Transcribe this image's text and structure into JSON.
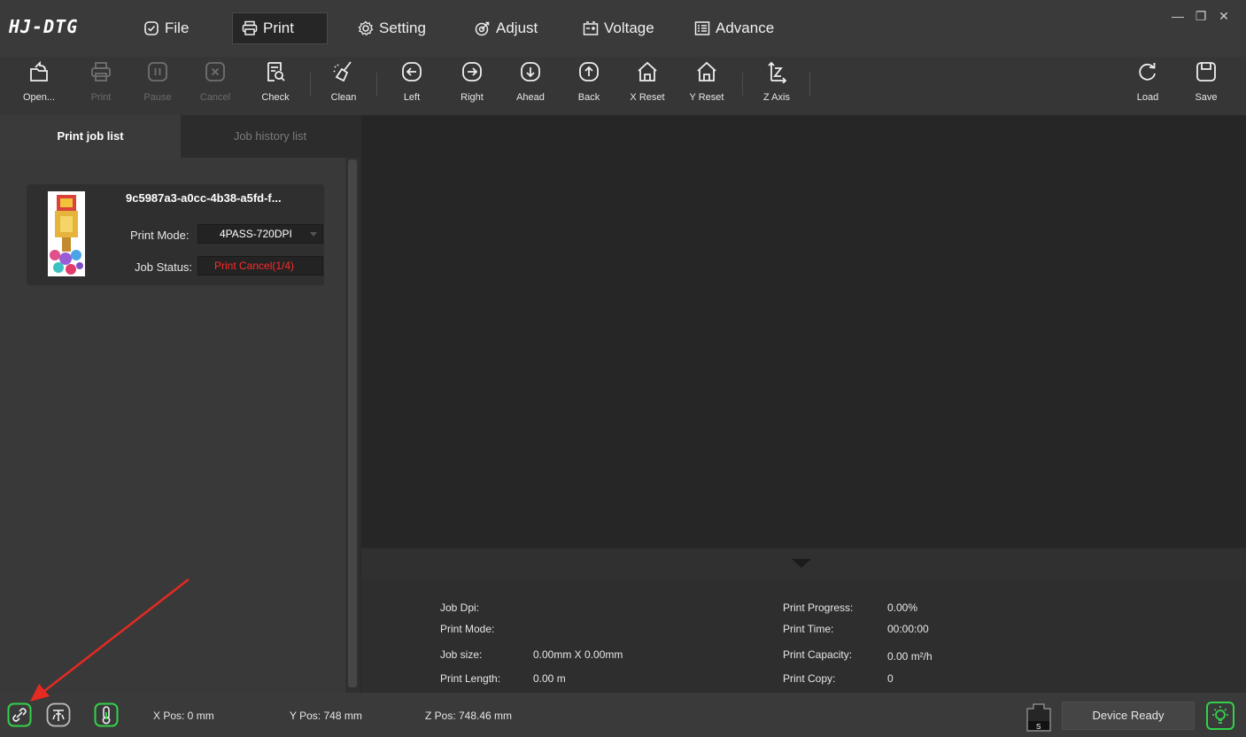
{
  "app": {
    "title": "HJ-DTG"
  },
  "menu": {
    "items": [
      {
        "label": "File",
        "icon": "file-check-icon"
      },
      {
        "label": "Print",
        "icon": "printer-icon",
        "active": true
      },
      {
        "label": "Setting",
        "icon": "gear-icon"
      },
      {
        "label": "Adjust",
        "icon": "target-icon"
      },
      {
        "label": "Voltage",
        "icon": "battery-icon"
      },
      {
        "label": "Advance",
        "icon": "list-icon"
      }
    ],
    "window_controls": {
      "minimize": "—",
      "restore": "❐",
      "close": "✕"
    }
  },
  "toolbar": {
    "open": "Open...",
    "print": "Print",
    "pause": "Pause",
    "cancel": "Cancel",
    "check": "Check",
    "clean": "Clean",
    "left": "Left",
    "right": "Right",
    "ahead": "Ahead",
    "back": "Back",
    "x_reset": "X Reset",
    "y_reset": "Y Reset",
    "z_axis": "Z Axis",
    "load": "Load",
    "save": "Save"
  },
  "left_panel": {
    "tabs": {
      "active": "Print job list",
      "inactive": "Job history list"
    },
    "job": {
      "name": "9c5987a3-a0cc-4b38-a5fd-f...",
      "mode_label": "Print Mode:",
      "mode_value": "4PASS-720DPI",
      "status_label": "Job Status:",
      "status_value": "Print Cancel(1/4)",
      "status_color": "#ff2a2a"
    }
  },
  "info": {
    "job_dpi_label": "Job Dpi:",
    "print_mode_label": "Print Mode:",
    "job_size_label": "Job size:",
    "job_size_value": "0.00mm X 0.00mm",
    "print_length_label": "Print Length:",
    "print_length_value": "0.00 m",
    "print_progress_label": "Print Progress:",
    "print_progress_value": "0.00%",
    "print_time_label": "Print Time:",
    "print_time_value": "00:00:00",
    "print_capacity_label": "Print Capacity:",
    "print_capacity_value": "0.00 m²/h",
    "print_copy_label": "Print Copy:",
    "print_copy_value": "0"
  },
  "status_bar": {
    "x_pos": "X Pos: 0 mm",
    "y_pos": "Y Pos: 748 mm",
    "z_pos": "Z Pos: 748.46 mm",
    "ink_label": "S",
    "device_status": "Device Ready",
    "accent_green": "#33d24a"
  }
}
